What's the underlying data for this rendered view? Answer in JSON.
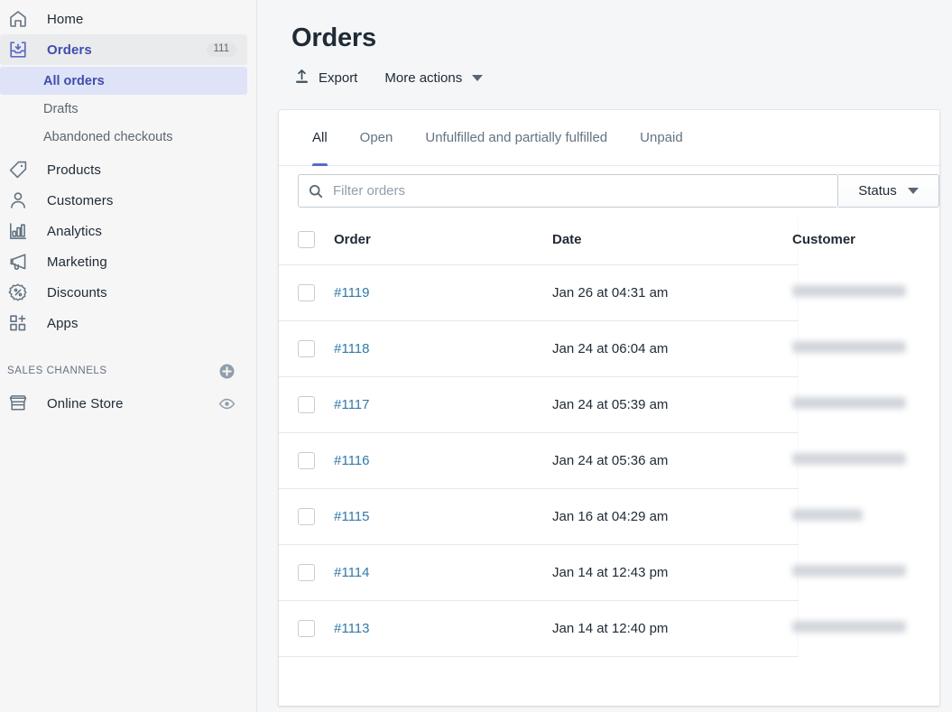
{
  "sidebar": {
    "items": [
      {
        "label": "Home",
        "icon": "home-icon",
        "badge": null
      },
      {
        "label": "Orders",
        "icon": "orders-inbox-icon",
        "badge": "111"
      },
      {
        "label": "Products",
        "icon": "products-tag-icon",
        "badge": null
      },
      {
        "label": "Customers",
        "icon": "customers-person-icon",
        "badge": null
      },
      {
        "label": "Analytics",
        "icon": "analytics-bar-chart-icon",
        "badge": null
      },
      {
        "label": "Marketing",
        "icon": "marketing-megaphone-icon",
        "badge": null
      },
      {
        "label": "Discounts",
        "icon": "discounts-percent-badge-icon",
        "badge": null
      },
      {
        "label": "Apps",
        "icon": "apps-grid-plus-icon",
        "badge": null
      }
    ],
    "orders_subitems": [
      {
        "label": "All orders",
        "selected": true
      },
      {
        "label": "Drafts",
        "selected": false
      },
      {
        "label": "Abandoned checkouts",
        "selected": false
      }
    ],
    "sales_channels": {
      "title": "Sales channels",
      "add_icon": "plus-circle-icon",
      "channels": [
        {
          "label": "Online Store",
          "icon": "online-store-icon",
          "action_icon": "eye-icon"
        }
      ]
    },
    "colors": {
      "background": "#f6f6f7",
      "active_parent_bg": "#eaebec",
      "selected_bg": "#dfe3f7",
      "accent": "#3f4eae",
      "border": "#dfe3e8"
    }
  },
  "header": {
    "title": "Orders",
    "export_label": "Export",
    "export_icon": "export-upload-icon",
    "more_actions_label": "More actions",
    "more_actions_icon": "chevron-down-icon"
  },
  "tabs": [
    {
      "label": "All",
      "active": true
    },
    {
      "label": "Open",
      "active": false
    },
    {
      "label": "Unfulfilled and partially fulfilled",
      "active": false
    },
    {
      "label": "Unpaid",
      "active": false
    }
  ],
  "filter": {
    "search_placeholder": "Filter orders",
    "search_value": "",
    "search_icon": "search-icon",
    "status_label": "Status",
    "status_icon": "chevron-down-icon"
  },
  "table": {
    "columns": [
      "Order",
      "Date",
      "Customer"
    ],
    "select_all_checkbox": false,
    "rows": [
      {
        "order": "#1119",
        "date": "Jan 26 at 04:31 am",
        "customer_redacted": true,
        "customer_width": 126
      },
      {
        "order": "#1118",
        "date": "Jan 24 at 06:04 am",
        "customer_redacted": true,
        "customer_width": 126
      },
      {
        "order": "#1117",
        "date": "Jan 24 at 05:39 am",
        "customer_redacted": true,
        "customer_width": 126
      },
      {
        "order": "#1116",
        "date": "Jan 24 at 05:36 am",
        "customer_redacted": true,
        "customer_width": 126
      },
      {
        "order": "#1115",
        "date": "Jan 16 at 04:29 am",
        "customer_redacted": true,
        "customer_width": 78
      },
      {
        "order": "#1114",
        "date": "Jan 14 at 12:43 pm",
        "customer_redacted": true,
        "customer_width": 126
      },
      {
        "order": "#1113",
        "date": "Jan 14 at 12:40 pm",
        "customer_redacted": true,
        "customer_width": 126
      }
    ]
  },
  "theme": {
    "page_bg": "#f4f6f8",
    "card_bg": "#ffffff",
    "text_primary": "#212b36",
    "text_secondary": "#637381",
    "link": "#3179a8",
    "tab_indicator": "#5c6ac4"
  }
}
